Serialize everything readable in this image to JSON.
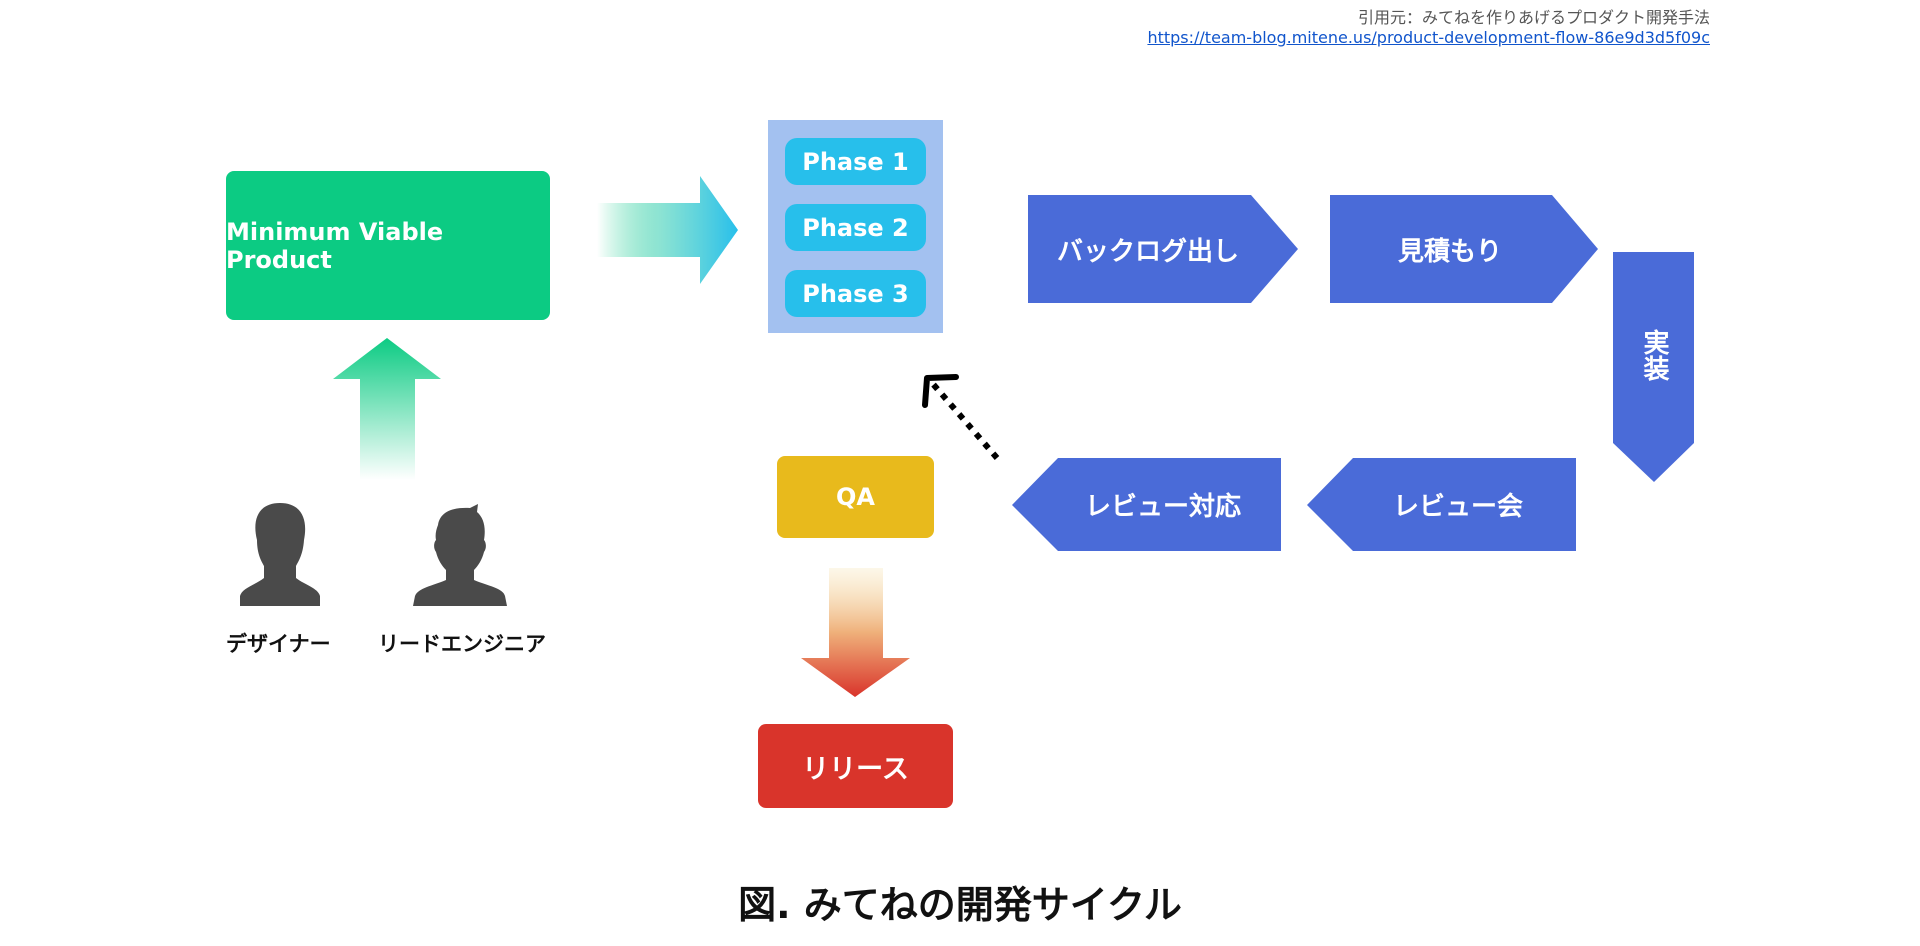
{
  "citation": {
    "source_label": "引用元：みてねを作りあげるプロダクト開発手法",
    "url_text": "https://team-blog.mitene.us/product-development-flow-86e9d3d5f09c"
  },
  "nodes": {
    "mvp": "Minimum Viable Product",
    "phases": [
      "Phase 1",
      "Phase 2",
      "Phase 3"
    ],
    "backlog": "バックログ出し",
    "estimate": "見積もり",
    "implement": "実装",
    "review_meeting": "レビュー会",
    "review_response": "レビュー対応",
    "qa": "QA",
    "release": "リリース"
  },
  "roles": {
    "designer": "デザイナー",
    "lead_engineer": "リードエンジニア"
  },
  "caption": "図. みてねの開発サイクル",
  "colors": {
    "mvp": "#0ccb83",
    "phase_panel": "#a3c1f0",
    "phase_pill": "#27bfeb",
    "process_step": "#4a6bd8",
    "qa": "#e8ba1c",
    "release": "#d9342b",
    "person_icon": "#4a4a4a",
    "link": "#1155cc"
  }
}
